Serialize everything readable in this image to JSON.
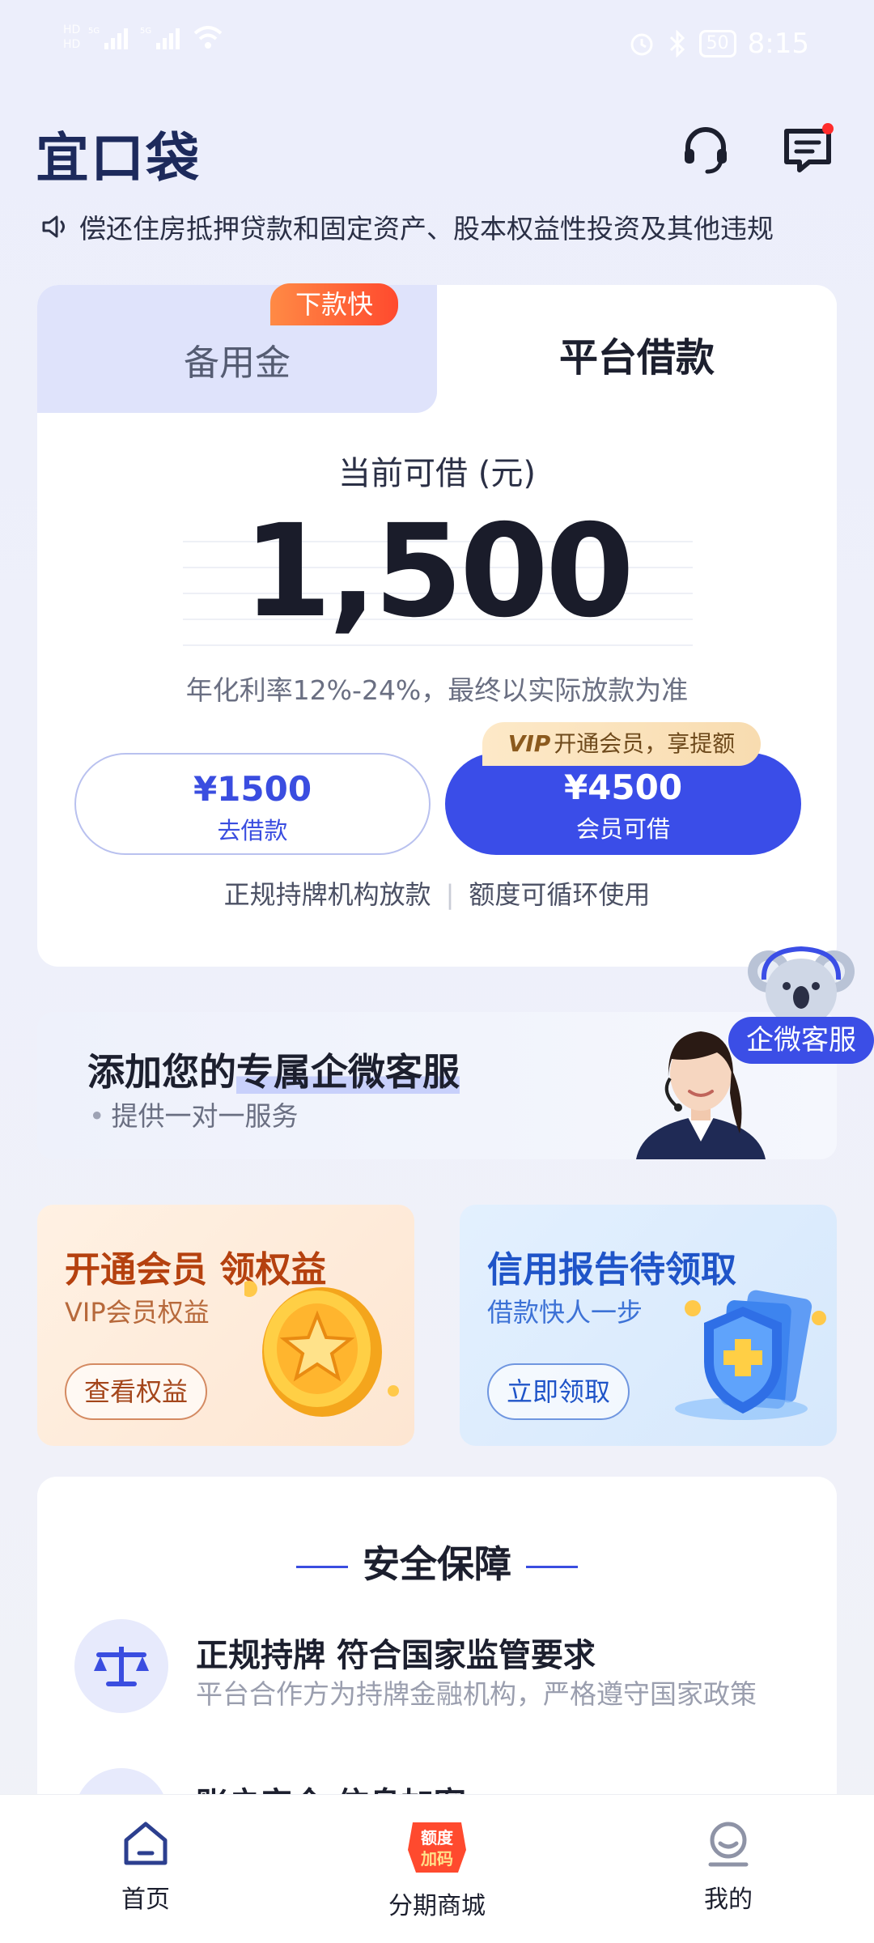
{
  "status_bar": {
    "sim1": "HD",
    "sim2": "HD",
    "net1": "5G",
    "net2": "5G",
    "battery": "50",
    "time": "8:15"
  },
  "header": {
    "logo": "宜口袋",
    "icons": [
      "headset-icon",
      "message-icon"
    ]
  },
  "notice": {
    "text": "偿还住房抵押贷款和固定资产、股本权益性投资及其他违规"
  },
  "loan_card": {
    "tabs": [
      {
        "label": "备用金"
      },
      {
        "label": "平台借款"
      }
    ],
    "fast_badge": "下款快",
    "available_label": "当前可借 (元)",
    "amount": "1,500",
    "rate_note": "年化利率12%-24%，最终以实际放款为准",
    "borrow_button": {
      "amount": "¥1500",
      "label": "去借款"
    },
    "vip_button": {
      "amount": "¥4500",
      "label": "会员可借"
    },
    "vip_tip": {
      "prefix": "VIP",
      "text": "开通会员，享提额"
    },
    "features": [
      "正规持牌机构放款",
      "额度可循环使用"
    ]
  },
  "service": {
    "title_pre": "添加您的",
    "title_hl": "专属企微客服",
    "subtitle": "提供一对一服务",
    "float_tag": "企微客服"
  },
  "promos": [
    {
      "title": "开通会员 领权益",
      "subtitle": "VIP会员权益",
      "button": "查看权益"
    },
    {
      "title": "信用报告待领取",
      "subtitle": "借款快人一步",
      "button": "立即领取"
    }
  ],
  "safety": {
    "title": "安全保障",
    "items": [
      {
        "title": "正规持牌 符合国家监管要求",
        "subtitle": "平台合作方为持牌金融机构，严格遵守国家政策"
      },
      {
        "title": "账户安全 信息加密",
        "subtitle": ""
      }
    ]
  },
  "tabbar": {
    "items": [
      {
        "label": "首页"
      },
      {
        "label": "分期商城",
        "badge": "额度加码"
      },
      {
        "label": "我的"
      }
    ]
  },
  "colors": {
    "primary": "#3a4de8",
    "tab_inactive_bg": "#dfe3fb",
    "badge_orange": "#ff5a30",
    "vip_gold": "#f8dcb0"
  }
}
